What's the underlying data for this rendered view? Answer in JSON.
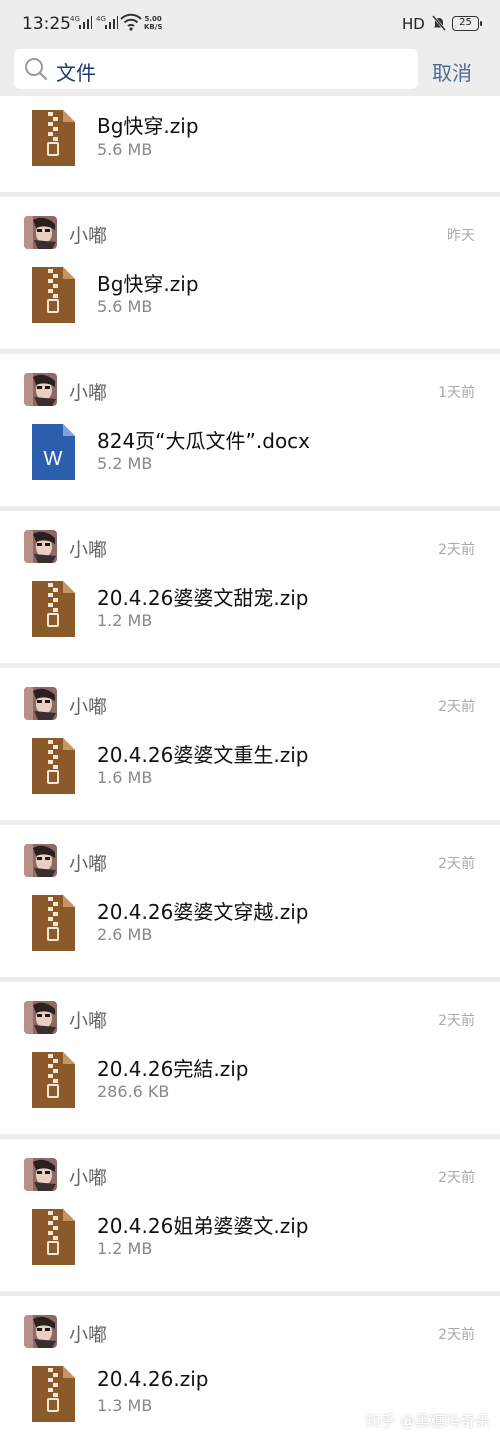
{
  "status_bar": {
    "time": "13:25",
    "signal_1": "4G",
    "signal_2": "4G",
    "net_speed_value": "5.00",
    "net_speed_unit": "KB/S",
    "hd": "HD",
    "battery": "25"
  },
  "search": {
    "query": "文件",
    "cancel_label": "取消"
  },
  "colors": {
    "zip_icon": "#8b5a2b",
    "doc_icon": "#2b5fad",
    "link_blue": "#4d6b98"
  },
  "messages": [
    {
      "sender": "",
      "time": "",
      "file_name": "Bg快穿.zip",
      "file_size": "5.6 MB",
      "icon": "zip-icon"
    },
    {
      "sender": "小嘟",
      "time": "昨天",
      "file_name": "Bg快穿.zip",
      "file_size": "5.6 MB",
      "icon": "zip-icon"
    },
    {
      "sender": "小嘟",
      "time": "1天前",
      "file_name": "824页“大瓜文件”.docx",
      "file_size": "5.2 MB",
      "icon": "word-doc-icon",
      "icon_letter": "W"
    },
    {
      "sender": "小嘟",
      "time": "2天前",
      "file_name": "20.4.26婆婆文甜宠.zip",
      "file_size": "1.2 MB",
      "icon": "zip-icon"
    },
    {
      "sender": "小嘟",
      "time": "2天前",
      "file_name": "20.4.26婆婆文重生.zip",
      "file_size": "1.6 MB",
      "icon": "zip-icon"
    },
    {
      "sender": "小嘟",
      "time": "2天前",
      "file_name": "20.4.26婆婆文穿越.zip",
      "file_size": "2.6 MB",
      "icon": "zip-icon"
    },
    {
      "sender": "小嘟",
      "time": "2天前",
      "file_name": "20.4.26完結.zip",
      "file_size": "286.6 KB",
      "icon": "zip-icon"
    },
    {
      "sender": "小嘟",
      "time": "2天前",
      "file_name": "20.4.26姐弟婆婆文.zip",
      "file_size": "1.2 MB",
      "icon": "zip-icon"
    },
    {
      "sender": "小嘟",
      "time": "2天前",
      "file_name": "20.4.26.zip",
      "file_size": "1.3 MB",
      "icon": "zip-icon"
    }
  ],
  "watermark": "知乎 @黑糖玛奇朵"
}
